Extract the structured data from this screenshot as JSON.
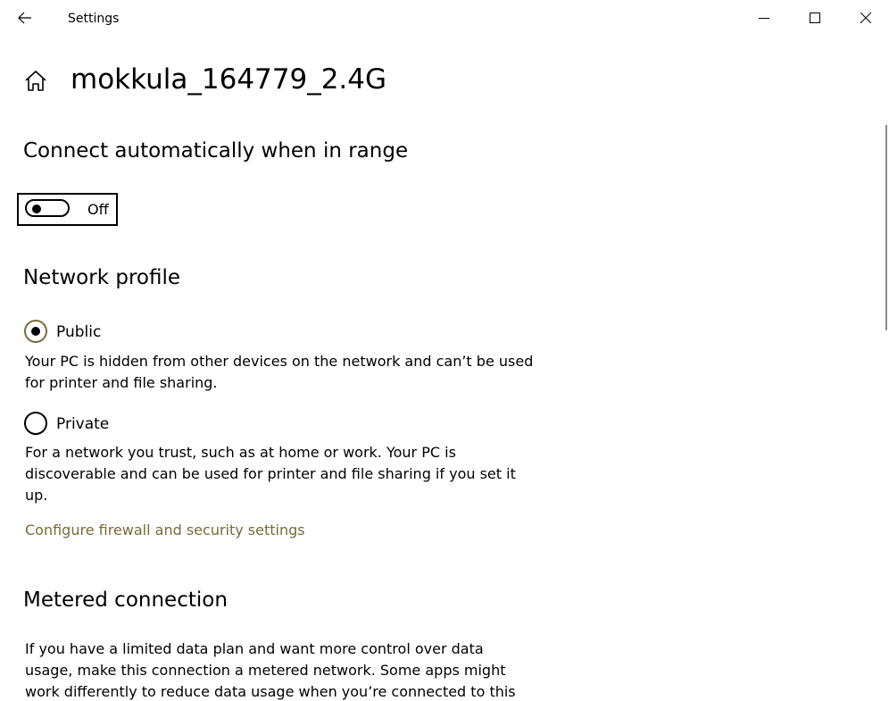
{
  "titlebar": {
    "app_title": "Settings",
    "icons": {
      "back": "back-arrow-icon",
      "minimize": "minimize-icon",
      "maximize": "maximize-icon",
      "close": "close-icon"
    }
  },
  "page": {
    "title": "mokkula_164779_2.4G",
    "home_icon": "home-icon"
  },
  "auto_connect": {
    "heading": "Connect automatically when in range",
    "toggle_state": "Off"
  },
  "network_profile": {
    "heading": "Network profile",
    "options": [
      {
        "label": "Public",
        "selected": true,
        "description": "Your PC is hidden from other devices on the network and can’t be used for printer and file sharing."
      },
      {
        "label": "Private",
        "selected": false,
        "description": "For a network you trust, such as at home or work. Your PC is discoverable and can be used for printer and file sharing if you set it up."
      }
    ],
    "firewall_link": "Configure firewall and security settings"
  },
  "metered": {
    "heading": "Metered connection",
    "description": "If you have a limited data plan and want more control over data usage, make this connection a metered network. Some apps might work differently to reduce data usage when you’re connected to this"
  },
  "colors": {
    "accent": "#786a38",
    "text": "#000000",
    "background": "#ffffff"
  }
}
